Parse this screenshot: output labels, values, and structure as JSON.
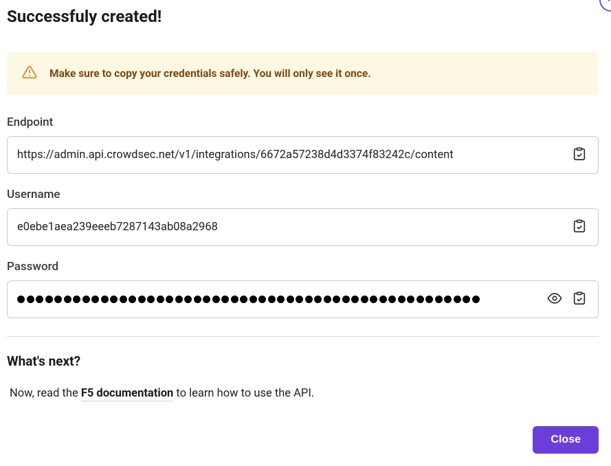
{
  "title": "Successfuly created!",
  "warning": {
    "text": "Make sure to copy your credentials safely. You will only see it once."
  },
  "fields": {
    "endpoint": {
      "label": "Endpoint",
      "value": "https://admin.api.crowdsec.net/v1/integrations/6672a57238d4d3374f83242c/content"
    },
    "username": {
      "label": "Username",
      "value": "e0ebe1aea239eeeb7287143ab08a2968"
    },
    "password": {
      "label": "Password",
      "masked_length": 50
    }
  },
  "whats_next": {
    "heading": "What's next?",
    "prefix": "Now, read the ",
    "link_text": "F5 documentation",
    "suffix": " to learn how to use the API."
  },
  "buttons": {
    "close": "Close"
  }
}
